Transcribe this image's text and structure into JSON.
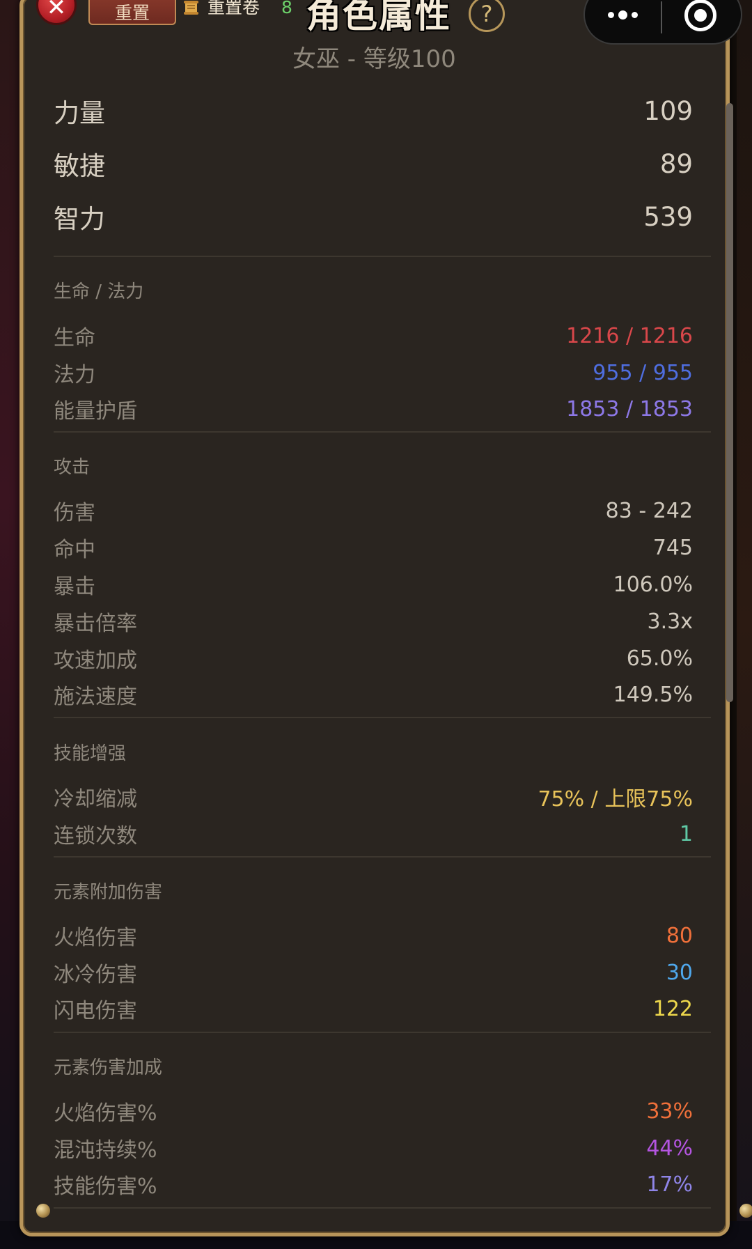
{
  "header": {
    "close_icon": "close-icon",
    "reset_label": "重置",
    "scroll_label": "重置卷",
    "scroll_count": "8",
    "title": "角色属性",
    "help_symbol": "?",
    "subtitle": "女巫 - 等级100"
  },
  "attributes": [
    {
      "label": "力量",
      "value": "109"
    },
    {
      "label": "敏捷",
      "value": "89"
    },
    {
      "label": "智力",
      "value": "539"
    }
  ],
  "sections": {
    "life": {
      "title": "生命 / 法力",
      "rows": [
        {
          "label": "生命",
          "value": "1216 / 1216",
          "color": "#d9474a"
        },
        {
          "label": "法力",
          "value": "955 / 955",
          "color": "#4f6ee0"
        },
        {
          "label": "能量护盾",
          "value": "1853 / 1853",
          "color": "#8d78e6"
        }
      ]
    },
    "attack": {
      "title": "攻击",
      "rows": [
        {
          "label": "伤害",
          "value": "83 - 242"
        },
        {
          "label": "命中",
          "value": "745"
        },
        {
          "label": "暴击",
          "value": "106.0%"
        },
        {
          "label": "暴击倍率",
          "value": "3.3x"
        },
        {
          "label": "攻速加成",
          "value": "65.0%"
        },
        {
          "label": "施法速度",
          "value": "149.5%"
        }
      ]
    },
    "skill": {
      "title": "技能增强",
      "rows": [
        {
          "label": "冷却缩减",
          "value": "75% / 上限75%",
          "color": "#e8c35a"
        },
        {
          "label": "连锁次数",
          "value": "1",
          "color": "#5fc9a5"
        }
      ]
    },
    "element_added": {
      "title": "元素附加伤害",
      "rows": [
        {
          "label": "火焰伤害",
          "value": "80",
          "color": "#f0703a"
        },
        {
          "label": "冰冷伤害",
          "value": "30",
          "color": "#4fa8ec"
        },
        {
          "label": "闪电伤害",
          "value": "122",
          "color": "#eed84c"
        }
      ]
    },
    "element_bonus": {
      "title": "元素伤害加成",
      "rows": [
        {
          "label": "火焰伤害%",
          "value": "33%",
          "color": "#f0703a"
        },
        {
          "label": "混沌持续%",
          "value": "44%",
          "color": "#b455e0"
        },
        {
          "label": "技能伤害%",
          "value": "17%",
          "color": "#8f85e8"
        }
      ]
    }
  },
  "colors": {
    "panel_bg": "#2a2520",
    "panel_border": "#b8955a",
    "accent_gold": "#d4b978"
  }
}
